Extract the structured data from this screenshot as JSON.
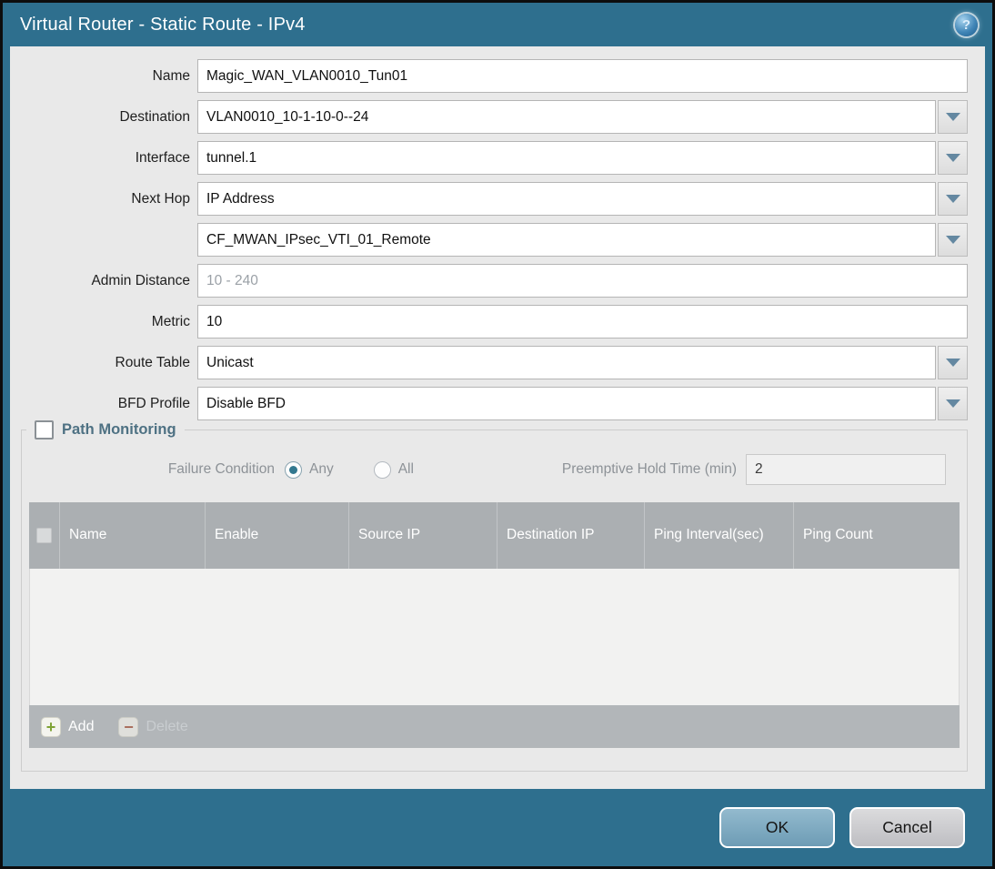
{
  "dialog": {
    "title": "Virtual Router - Static Route - IPv4"
  },
  "icons": {
    "help": "?",
    "add": "+",
    "delete": "−"
  },
  "form": {
    "fields": [
      {
        "label": "Name",
        "value": "Magic_WAN_VLAN0010_Tun01",
        "type": "text"
      },
      {
        "label": "Destination",
        "value": "VLAN0010_10-1-10-0--24",
        "type": "dropdown"
      },
      {
        "label": "Interface",
        "value": "tunnel.1",
        "type": "dropdown"
      },
      {
        "label": "Next Hop",
        "value": "IP Address",
        "type": "dropdown"
      },
      {
        "label": "",
        "value": "CF_MWAN_IPsec_VTI_01_Remote",
        "type": "dropdown"
      },
      {
        "label": "Admin Distance",
        "value": "",
        "placeholder": "10 - 240",
        "type": "text"
      },
      {
        "label": "Metric",
        "value": "10",
        "type": "text"
      },
      {
        "label": "Route Table",
        "value": "Unicast",
        "type": "dropdown"
      },
      {
        "label": "BFD Profile",
        "value": "Disable BFD",
        "type": "dropdown"
      }
    ]
  },
  "path_monitoring": {
    "title": "Path Monitoring",
    "checkbox_checked": false,
    "failure_condition_label": "Failure Condition",
    "options": [
      "Any",
      "All"
    ],
    "selected_option": "Any",
    "preemptive_label": "Preemptive Hold Time (min)",
    "preemptive_value": "2",
    "table": {
      "columns": [
        "Name",
        "Enable",
        "Source IP",
        "Destination IP",
        "Ping Interval(sec)",
        "Ping Count"
      ],
      "rows": []
    },
    "add_label": "Add",
    "delete_label": "Delete"
  },
  "footer": {
    "ok_label": "OK",
    "cancel_label": "Cancel"
  },
  "colors": {
    "titlebar_teal": "#2e6f8e",
    "content_bg": "#e9e9e9",
    "table_header_bg": "#abafb2",
    "toolbar_bg": "#b2b6b9",
    "ok_button_blue": "#7aa6bd",
    "cancel_button_gray": "#c9c9cd",
    "radio_selected_teal": "#33788f",
    "add_icon_green": "#7fa336",
    "delete_icon_red": "#a8624e",
    "section_title_teal": "#4e7183"
  }
}
